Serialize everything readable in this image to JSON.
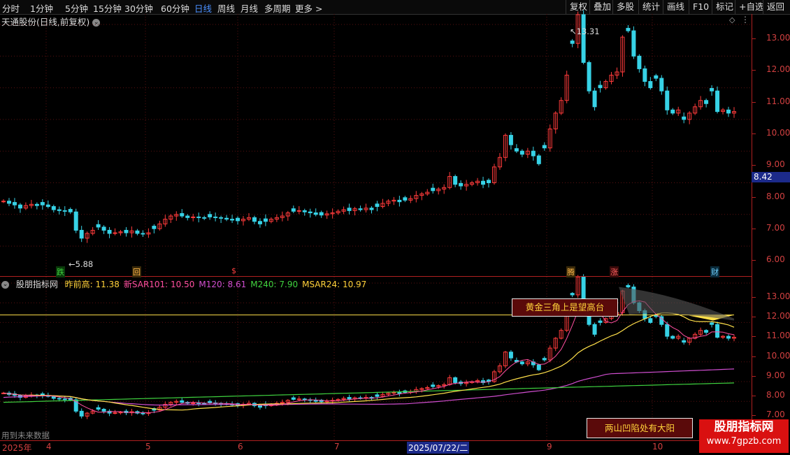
{
  "toolbar": {
    "periods": [
      "分时",
      "1分钟",
      "5分钟",
      "15分钟",
      "30分钟",
      "60分钟",
      "日线",
      "周线",
      "月线",
      "多周期",
      "更多 >"
    ],
    "active_period": "日线",
    "tools": [
      "复权",
      "叠加",
      "多股",
      "统计",
      "画线",
      "F10",
      "标记",
      "+自选",
      "返回"
    ]
  },
  "stock": {
    "title": "天通股份(日线,前复权)",
    "high_label": "13.31",
    "low_label": "5.88",
    "current_price": "8.42"
  },
  "price_axis": [
    "13.00",
    "12.00",
    "11.00",
    "10.00",
    "9.00",
    "8.00",
    "7.00",
    "6.00"
  ],
  "indicator": {
    "name": "股朋指标网",
    "values": [
      {
        "label": "昨前高: 11.38",
        "color": "#ffd23a"
      },
      {
        "label": "新SAR101: 10.50",
        "color": "#ff4fa0"
      },
      {
        "label": "M120: 8.61",
        "color": "#d04ed0"
      },
      {
        "label": "M240: 7.90",
        "color": "#3fd23f"
      },
      {
        "label": "MSAR24: 10.97",
        "color": "#ffd23a"
      }
    ],
    "axis": [
      "13.00",
      "12.00",
      "11.00",
      "10.00",
      "9.00",
      "8.00",
      "7.00"
    ],
    "box_top": "黄金三角上是望高台",
    "box_bottom": "两山凹陷处有大阳",
    "future_text": "用到未来数据"
  },
  "markers": [
    {
      "text": "跌",
      "color": "#3fd23f",
      "bg": "#0a3a0a"
    },
    {
      "text": "回",
      "color": "#ffb84a",
      "bg": "#3a2a0a"
    },
    {
      "text": "$",
      "color": "#ff4040",
      "bg": "#000"
    },
    {
      "text": "腾",
      "color": "#ffb84a",
      "bg": "#3a2a0a"
    },
    {
      "text": "涨",
      "color": "#ff6060",
      "bg": "#3a0a0a"
    },
    {
      "text": "财",
      "color": "#6fd0ff",
      "bg": "#0a2a3a"
    }
  ],
  "dates": [
    "2025年",
    "4",
    "5",
    "6",
    "7",
    "2025/07/22/二",
    "9",
    "10"
  ],
  "colors": {
    "up": "#ff3b3b",
    "down": "#37d2e6",
    "axis": "#d24040"
  },
  "watermark": {
    "line1": "股朋指标网",
    "line2": "www.7gpzb.com"
  },
  "chart_data": {
    "type": "candlestick",
    "closes": [
      7.42,
      7.35,
      7.3,
      7.2,
      7.28,
      7.32,
      7.28,
      7.3,
      7.25,
      7.15,
      7.12,
      7.1,
      7.08,
      6.5,
      6.25,
      6.4,
      6.5,
      6.6,
      6.5,
      6.4,
      6.42,
      6.45,
      6.42,
      6.48,
      6.4,
      6.38,
      6.42,
      6.55,
      6.7,
      6.85,
      6.95,
      7.0,
      6.95,
      6.9,
      6.92,
      6.9,
      6.88,
      6.92,
      6.9,
      6.88,
      6.85,
      6.82,
      6.8,
      6.85,
      6.9,
      6.78,
      6.7,
      6.78,
      6.85,
      6.9,
      6.95,
      7.05,
      7.1,
      7.12,
      7.08,
      7.05,
      7.0,
      6.98,
      7.02,
      7.05,
      7.1,
      7.15,
      7.12,
      7.18,
      7.15,
      7.2,
      7.15,
      7.25,
      7.35,
      7.42,
      7.45,
      7.4,
      7.45,
      7.5,
      7.6,
      7.65,
      7.7,
      7.75,
      7.8,
      7.85,
      8.2,
      7.95,
      7.9,
      7.95,
      8.0,
      8.05,
      7.95,
      8.0,
      8.5,
      8.8,
      9.5,
      9.2,
      9.0,
      8.9,
      9.0,
      8.85,
      8.6,
      9.1,
      9.7,
      10.2,
      10.6,
      11.4,
      12.4,
      13.31,
      11.8,
      10.9,
      10.4,
      11.0,
      11.2,
      11.4,
      11.5,
      12.6,
      12.8,
      12.0,
      11.6,
      11.2,
      11.0,
      11.3,
      10.9,
      10.3,
      10.2,
      10.3,
      10.0,
      10.2,
      10.4,
      10.6,
      10.5,
      10.9,
      10.25,
      10.3,
      10.2,
      10.25
    ]
  }
}
